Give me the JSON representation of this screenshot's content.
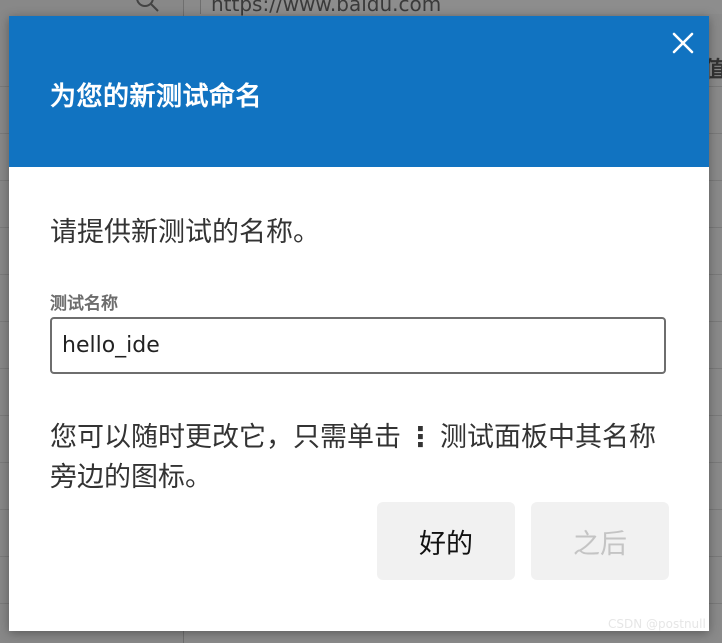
{
  "background": {
    "url_text": "https://www.baidu.com",
    "partial_char": "值"
  },
  "dialog": {
    "title": "为您的新测试命名",
    "prompt": "请提供新测试的名称。",
    "field_label": "测试名称",
    "field_value": "hello_ide",
    "hint_before_icon": "您可以随时更改它，只需单击",
    "hint_icon": "⋮",
    "hint_after_icon": "测试面板中其名称旁边的图标。",
    "ok_label": "好的",
    "later_label": "之后",
    "header_color": "#1173c1"
  },
  "watermark": "CSDN @postnull"
}
